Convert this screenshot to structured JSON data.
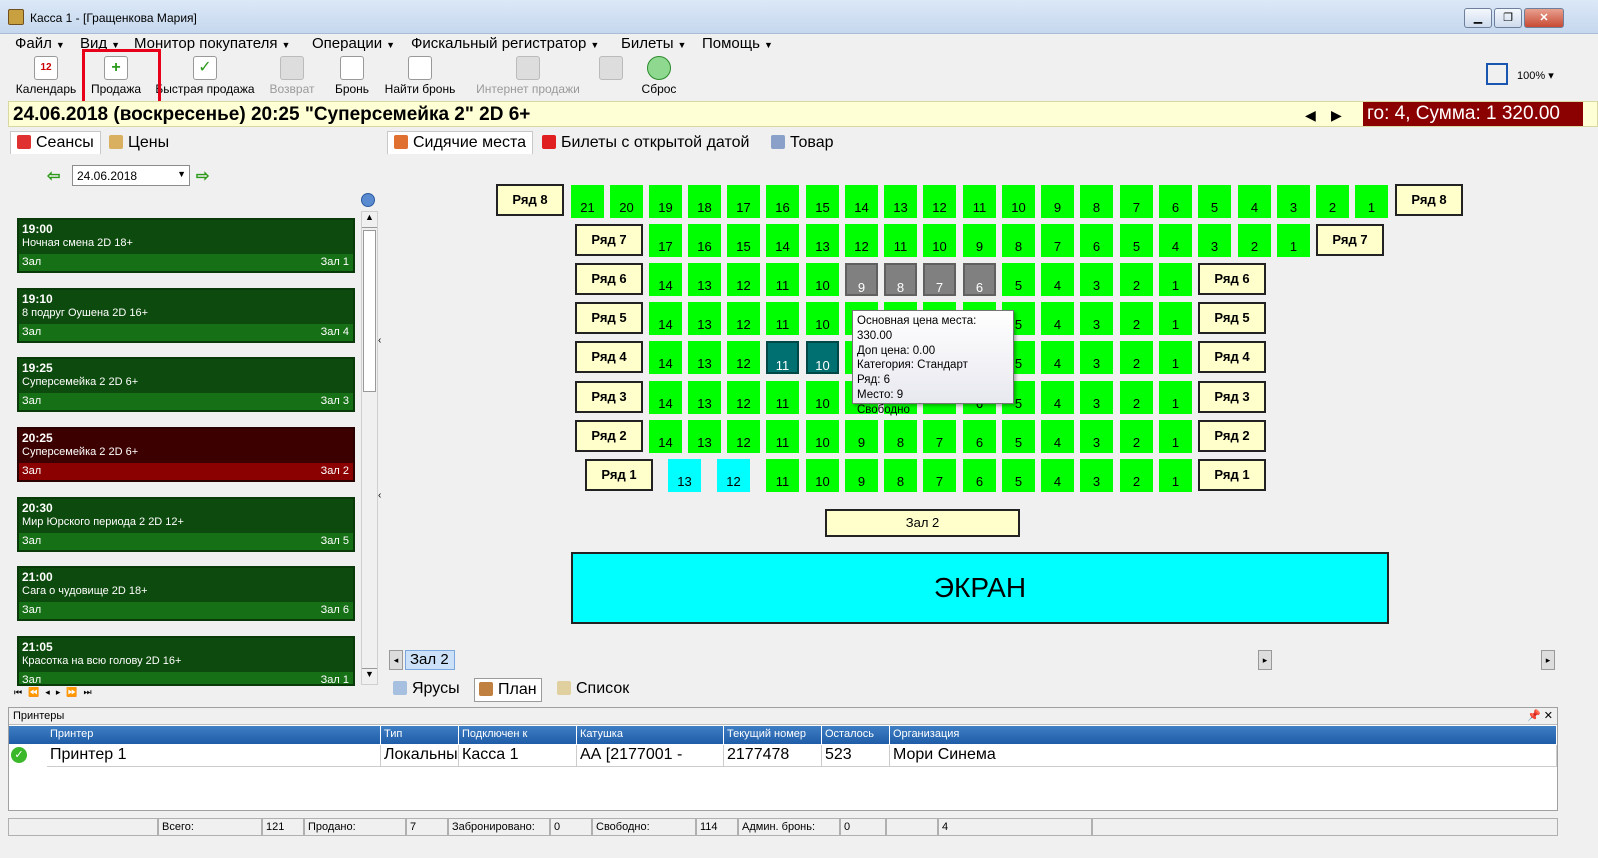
{
  "window": {
    "title": "Касса 1 - [Гращенкова Мария]"
  },
  "menu": [
    "Файл",
    "Вид",
    "Монитор покупателя",
    "Операции",
    "Фискальный регистратор",
    "Билеты",
    "Помощь"
  ],
  "toolbar": {
    "calendar": "Календарь",
    "calendar_day": "12",
    "sale": "Продажа",
    "quick_sale": "Быстрая продажа",
    "refund": "Возврат",
    "booking": "Бронь",
    "find_booking": "Найти бронь",
    "online_sales": "Интернет продажи",
    "reset": "Сброс",
    "zoom": "100%"
  },
  "info": {
    "title": "24.06.2018  (воскресенье) 20:25  \"Суперсемейка 2\" 2D 6+",
    "summary": "го: 4, Сумма: 1 320.00"
  },
  "left_tabs": {
    "sessions": "Сеансы",
    "prices": "Цены"
  },
  "date": "24.06.2018",
  "sessions": [
    {
      "time": "19:00",
      "name": "Ночная смена  2D 18+",
      "left": "Зал",
      "hall": "Зал 1",
      "selected": false
    },
    {
      "time": "19:10",
      "name": "8 подруг Оушена  2D 16+",
      "left": "Зал",
      "hall": "Зал 4",
      "selected": false
    },
    {
      "time": "19:25",
      "name": "Суперсемейка 2 2D 6+",
      "left": "Зал",
      "hall": "Зал 3",
      "selected": false
    },
    {
      "time": "20:25",
      "name": "Суперсемейка 2 2D 6+",
      "left": "Зал",
      "hall": "Зал 2",
      "selected": true
    },
    {
      "time": "20:30",
      "name": "Мир Юрского периода 2  2D 12+",
      "left": "Зал",
      "hall": "Зал 5",
      "selected": false
    },
    {
      "time": "21:00",
      "name": "Сага о чудовище 2D 18+",
      "left": "Зал",
      "hall": "Зал 6",
      "selected": false
    },
    {
      "time": "21:05",
      "name": "Красотка на всю голову  2D 16+",
      "left": "Зал",
      "hall": "Зал 1",
      "selected": false
    }
  ],
  "main_tabs": {
    "seats": "Сидячие места",
    "open_date": "Билеты с открытой датой",
    "goods": "Товар"
  },
  "rows": {
    "r8": "Ряд 8",
    "r7": "Ряд 7",
    "r6": "Ряд 6",
    "r5": "Ряд 5",
    "r4": "Ряд 4",
    "r3": "Ряд 3",
    "r2": "Ряд 2",
    "r1": "Ряд 1"
  },
  "seat_numbers": {
    "row8": [
      "21",
      "20",
      "19",
      "18",
      "17",
      "16",
      "15",
      "14",
      "13",
      "12",
      "11",
      "10",
      "9",
      "8",
      "7",
      "6",
      "5",
      "4",
      "3",
      "2",
      "1"
    ],
    "row7": [
      "17",
      "16",
      "15",
      "14",
      "13",
      "12",
      "11",
      "10",
      "9",
      "8",
      "7",
      "6",
      "5",
      "4",
      "3",
      "2",
      "1"
    ],
    "row6": [
      "14",
      "13",
      "12",
      "11",
      "10",
      "9",
      "8",
      "7",
      "6",
      "5",
      "4",
      "3",
      "2",
      "1"
    ],
    "row5": [
      "14",
      "13",
      "12",
      "11",
      "10",
      "5",
      "4",
      "3",
      "2",
      "1"
    ],
    "row4": [
      "14",
      "13",
      "12",
      "11",
      "10",
      "5",
      "4",
      "3",
      "2",
      "1"
    ],
    "row3": [
      "14",
      "13",
      "12",
      "11",
      "10",
      "6",
      "5",
      "4",
      "3",
      "2",
      "1"
    ],
    "row2": [
      "14",
      "13",
      "12",
      "11",
      "10",
      "9",
      "8",
      "7",
      "6",
      "5",
      "4",
      "3",
      "2",
      "1"
    ],
    "row1": [
      "13",
      "12",
      "11",
      "10",
      "9",
      "8",
      "7",
      "6",
      "5",
      "4",
      "3",
      "2",
      "1"
    ]
  },
  "hall_label": "Зал 2",
  "screen_label": "ЭКРАН",
  "tooltip": {
    "price": "Основная цена места: 330.00",
    "extra": "Доп цена: 0.00",
    "category": "Категория: Стандарт",
    "row": "Ряд: 6",
    "place": "Место: 9",
    "status": "Свободно"
  },
  "hall_tab": "Зал 2",
  "view_tabs": {
    "tiers": "Ярусы",
    "plan": "План",
    "list": "Список"
  },
  "printers": {
    "panel_title": "Принтеры",
    "headers": [
      "Принтер",
      "Тип",
      "Подключен к",
      "Катушка",
      "Текущий номер",
      "Осталось",
      "Организация"
    ],
    "row": [
      "Принтер 1",
      "Локальны",
      "Касса 1",
      "АА [2177001 -",
      "2177478",
      "523",
      "Мори Синема"
    ]
  },
  "status": {
    "total_label": "Всего:",
    "total": "121",
    "sold_label": "Продано:",
    "sold": "7",
    "booked_label": "Забронировано:",
    "booked": "0",
    "free_label": "Свободно:",
    "free": "114",
    "admin_label": "Админ. бронь:",
    "admin": "0",
    "extra": "4"
  }
}
